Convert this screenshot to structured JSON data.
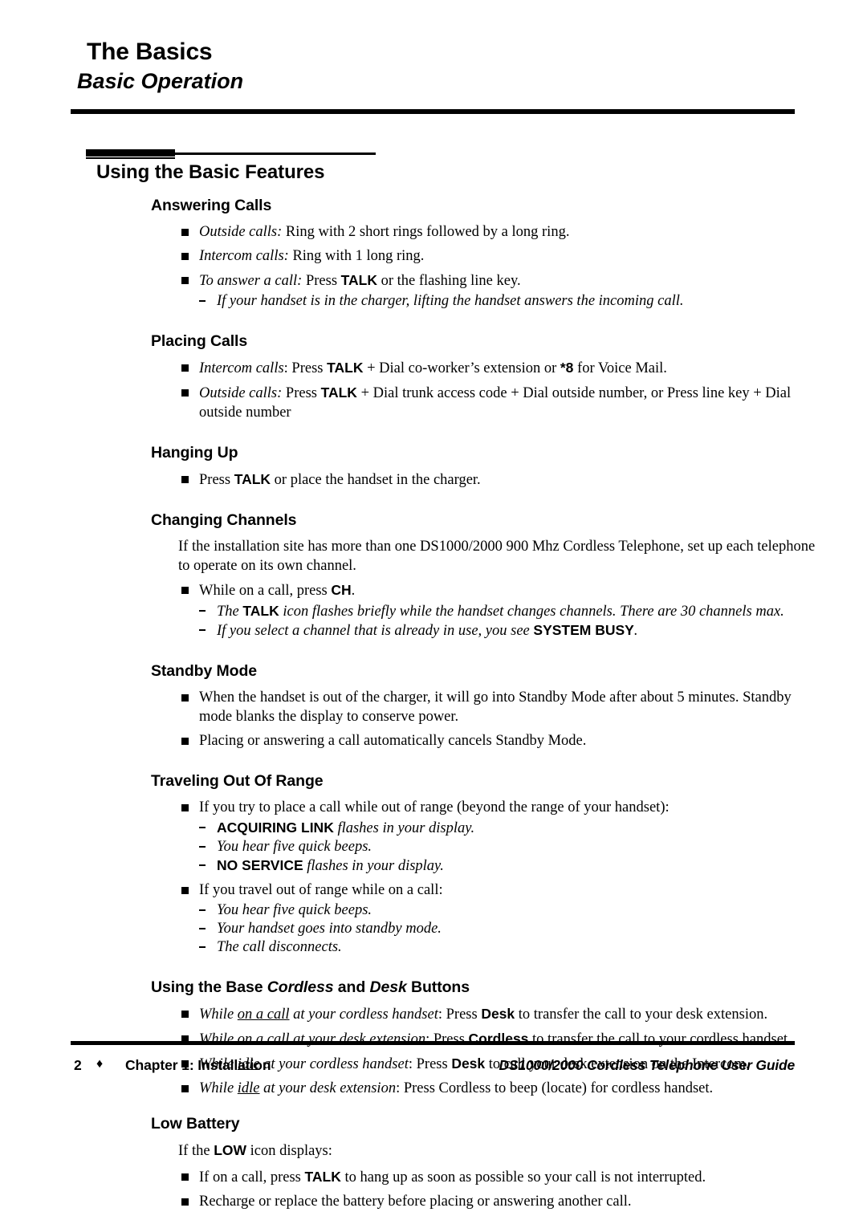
{
  "running_head": {
    "title": "The Basics",
    "subtitle": "Basic Operation"
  },
  "section": {
    "title": "Using the Basic Features"
  },
  "subsections": {
    "answering_calls": {
      "heading": "Answering Calls",
      "b1_em": "Outside calls:",
      "b1_rest": " Ring with 2 short rings followed by a long ring.",
      "b2_em": "Intercom calls:",
      "b2_rest": " Ring with 1 long ring.",
      "b3_em": "To answer a call:",
      "b3_mid": " Press ",
      "b3_bold": "TALK",
      "b3_end": " or the flashing line key.",
      "b3_sub1": "If your handset is in the charger, lifting the handset answers the incoming call."
    },
    "placing_calls": {
      "heading": "Placing Calls",
      "b1_em": "Intercom calls",
      "b1_a": ": Press ",
      "b1_bold1": "TALK",
      "b1_b": " + Dial co-worker’s extension or ",
      "b1_bold2": "*8",
      "b1_c": " for Voice Mail.",
      "b2_em": "Outside calls:",
      "b2_a": " Press ",
      "b2_bold1": "TALK",
      "b2_b": " + Dial trunk access code + Dial outside number, or Press line key + Dial outside number"
    },
    "hanging_up": {
      "heading": "Hanging Up",
      "b1_a": "Press ",
      "b1_bold": "TALK",
      "b1_b": " or place the handset in the charger."
    },
    "changing_channels": {
      "heading": "Changing Channels",
      "para": "If the installation site has more than one DS1000/2000 900 Mhz Cordless Telephone, set up each telephone to operate on its own channel.",
      "b1_a": "While on a call, press ",
      "b1_bold": "CH",
      "b1_b": ".",
      "sub1_a": "The ",
      "sub1_bold": "TALK",
      "sub1_b": " icon flashes briefly while the handset changes channels. There are 30 channels max.",
      "sub2_a": "If you select a channel that is already in use, you see ",
      "sub2_bold": "SYSTEM BUSY",
      "sub2_b": "."
    },
    "standby_mode": {
      "heading": "Standby Mode",
      "b1": "When the handset is out of the charger, it will go into Standby Mode after about 5 minutes. Standby mode blanks the display to conserve power.",
      "b2": "Placing or answering a call automatically cancels Standby Mode."
    },
    "traveling_out_of_range": {
      "heading": "Traveling Out Of Range",
      "b1": "If you try to place a call while out of range (beyond the range of your handset):",
      "b1_sub1_bold": "ACQUIRING LINK",
      "b1_sub1_rest": " flashes in your display.",
      "b1_sub2": "You hear five quick beeps.",
      "b1_sub3_bold": "NO SERVICE",
      "b1_sub3_rest": " flashes in your display.",
      "b2": "If you travel out of range while on a call:",
      "b2_sub1": "You hear five quick beeps.",
      "b2_sub2": "Your handset goes into standby mode.",
      "b2_sub3": "The call disconnects."
    },
    "base_buttons": {
      "heading_a": "Using the Base ",
      "heading_em1": "Cordless",
      "heading_b": " and ",
      "heading_em2": "Desk",
      "heading_c": " Buttons",
      "b1_em_a": "While ",
      "b1_em_u": "on a call",
      "b1_em_b": " at your cordless handset",
      "b1_a": ": Press ",
      "b1_bold": "Desk",
      "b1_b": " to transfer the call to your desk extension.",
      "b2_em_a": "While ",
      "b2_em_u": "on a call",
      "b2_em_b": " at your desk extension",
      "b2_a": ": Press ",
      "b2_bold": "Cordless",
      "b2_b": " to transfer the call to your cordless handset.",
      "b3_em_a": "While ",
      "b3_em_u": "idle",
      "b3_em_b": " at your cordless handset",
      "b3_a": ": Press ",
      "b3_bold": "Desk",
      "b3_b": " to call your desk extension on the Intercom.",
      "b4_em_a": "While ",
      "b4_em_u": "idle",
      "b4_em_b": " at your desk extension",
      "b4_a": ": Press Cordless to beep (locate) for cordless handset."
    },
    "low_battery": {
      "heading": "Low Battery",
      "para_a": "If the ",
      "para_bold": "LOW",
      "para_b": " icon displays:",
      "b1_a": "If on a call, press ",
      "b1_bold": "TALK",
      "b1_b": " to hang up as soon as possible so your call is not interrupted.",
      "b2": "Recharge or replace the battery before placing or answering another call."
    }
  },
  "footer": {
    "page_number": "2",
    "separator_icon": "♦",
    "chapter": "Chapter 1: Installation",
    "guide": "DS1000/2000 Cordless Telephone User Guide"
  },
  "colors": {
    "ink": "#000000",
    "paper": "#ffffff"
  }
}
